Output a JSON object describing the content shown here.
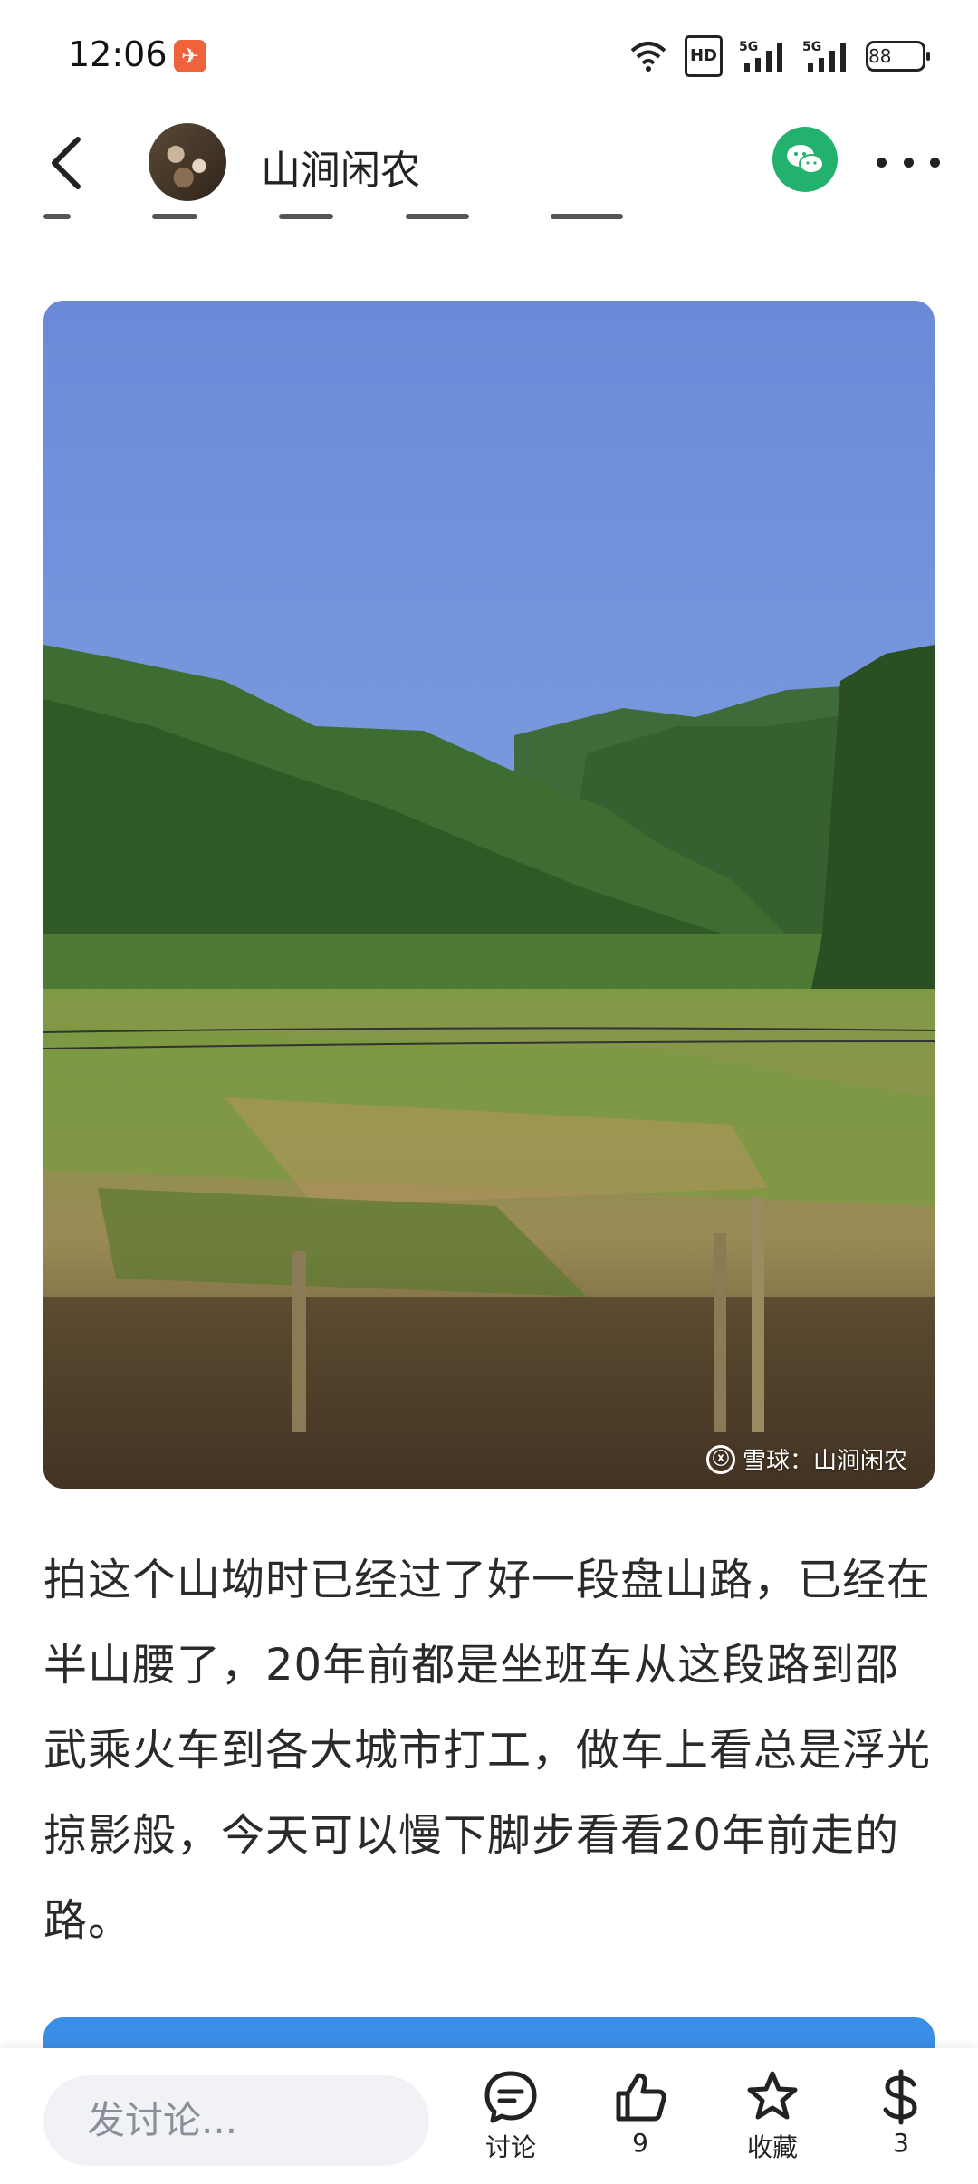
{
  "status_bar": {
    "time": "12:06",
    "hd_label": "HD",
    "network_1": "5G",
    "network_2": "5G",
    "battery": "88"
  },
  "header": {
    "author_name": "山涧闲农"
  },
  "post": {
    "image_watermark": "雪球：山涧闲农",
    "body": "拍这个山坳时已经过了好一段盘山路，已经在半山腰了，20年前都是坐班车从这段路到邵武乘火车到各大城市打工，做车上看总是浮光掠影般，今天可以慢下脚步看看20年前走的路。"
  },
  "bottom_bar": {
    "comment_placeholder": "发讨论...",
    "discuss_label": "讨论",
    "like_count": "9",
    "favorite_label": "收藏",
    "reward_count": "3"
  },
  "colors": {
    "accent_green": "#22b26d",
    "card_blue": "#3a8ee6",
    "sky_blue": "#6f8fd9"
  }
}
